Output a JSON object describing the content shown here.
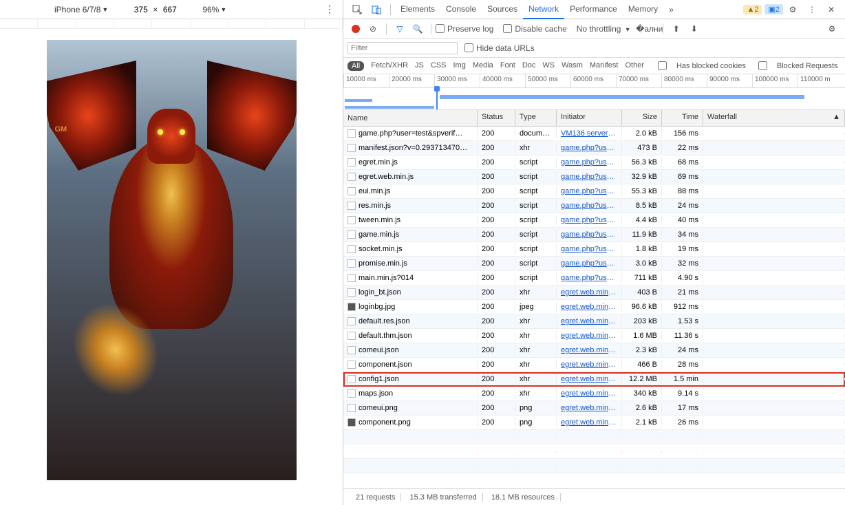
{
  "deviceToolbar": {
    "device": "iPhone 6/7/8",
    "width": "375",
    "height": "667",
    "zoom": "96%"
  },
  "viewport": {
    "gmBadge": "GM"
  },
  "tabs": {
    "items": [
      "Elements",
      "Console",
      "Sources",
      "Network",
      "Performance",
      "Memory"
    ],
    "more": "»",
    "warnCount": "2",
    "infoCount": "2"
  },
  "controls": {
    "preserve": "Preserve log",
    "disableCache": "Disable cache",
    "throttling": "No throttling"
  },
  "filter": {
    "placeholder": "Filter",
    "hideData": "Hide data URLs"
  },
  "types": [
    "All",
    "Fetch/XHR",
    "JS",
    "CSS",
    "Img",
    "Media",
    "Font",
    "Doc",
    "WS",
    "Wasm",
    "Manifest",
    "Other"
  ],
  "typesExtra": {
    "blockedCookies": "Has blocked cookies",
    "blockedReq": "Blocked Requests"
  },
  "timeTicks": [
    "10000 ms",
    "20000 ms",
    "30000 ms",
    "40000 ms",
    "50000 ms",
    "60000 ms",
    "70000 ms",
    "80000 ms",
    "90000 ms",
    "100000 ms",
    "110000 m"
  ],
  "columns": {
    "name": "Name",
    "status": "Status",
    "type": "Type",
    "initiator": "Initiator",
    "size": "Size",
    "time": "Time",
    "waterfall": "Waterfall"
  },
  "requests": [
    {
      "name": "game.php?user=test&spverif…",
      "status": "200",
      "type": "docum…",
      "initiator": "VM136 server1…",
      "size": "2.0 kB",
      "time": "156 ms",
      "wfStart": 0,
      "wfLen": 3,
      "ico": "doc"
    },
    {
      "name": "manifest.json?v=0.293713470…",
      "status": "200",
      "type": "xhr",
      "initiator": "game.php?use…",
      "size": "473 B",
      "time": "22 ms",
      "wfStart": 0,
      "wfLen": 2,
      "ico": "doc"
    },
    {
      "name": "egret.min.js",
      "status": "200",
      "type": "script",
      "initiator": "game.php?use…",
      "size": "56.3 kB",
      "time": "68 ms",
      "wfStart": 0,
      "wfLen": 3,
      "ico": "doc"
    },
    {
      "name": "egret.web.min.js",
      "status": "200",
      "type": "script",
      "initiator": "game.php?use…",
      "size": "32.9 kB",
      "time": "69 ms",
      "wfStart": 0,
      "wfLen": 3,
      "ico": "doc"
    },
    {
      "name": "eui.min.js",
      "status": "200",
      "type": "script",
      "initiator": "game.php?use…",
      "size": "55.3 kB",
      "time": "88 ms",
      "wfStart": 0,
      "wfLen": 3,
      "ico": "doc"
    },
    {
      "name": "res.min.js",
      "status": "200",
      "type": "script",
      "initiator": "game.php?use…",
      "size": "8.5 kB",
      "time": "24 ms",
      "wfStart": 1,
      "wfLen": 2,
      "ico": "doc"
    },
    {
      "name": "tween.min.js",
      "status": "200",
      "type": "script",
      "initiator": "game.php?use…",
      "size": "4.4 kB",
      "time": "40 ms",
      "wfStart": 1,
      "wfLen": 3,
      "ico": "doc"
    },
    {
      "name": "game.min.js",
      "status": "200",
      "type": "script",
      "initiator": "game.php?use…",
      "size": "11.9 kB",
      "time": "34 ms",
      "wfStart": 2,
      "wfLen": 2,
      "ico": "doc"
    },
    {
      "name": "socket.min.js",
      "status": "200",
      "type": "script",
      "initiator": "game.php?use…",
      "size": "1.8 kB",
      "time": "19 ms",
      "wfStart": 2,
      "wfLen": 2,
      "ico": "doc"
    },
    {
      "name": "promise.min.js",
      "status": "200",
      "type": "script",
      "initiator": "game.php?use…",
      "size": "3.0 kB",
      "time": "32 ms",
      "wfStart": 3,
      "wfLen": 2,
      "ico": "doc"
    },
    {
      "name": "main.min.js?014",
      "status": "200",
      "type": "script",
      "initiator": "game.php?use…",
      "size": "711 kB",
      "time": "4.90 s",
      "wfStart": 3,
      "wfLen": 9,
      "ico": "doc"
    },
    {
      "name": "login_bt.json",
      "status": "200",
      "type": "xhr",
      "initiator": "egret.web.min.…",
      "size": "403 B",
      "time": "21 ms",
      "wfStart": 12,
      "wfLen": 2,
      "ico": "doc"
    },
    {
      "name": "loginbg.jpg",
      "status": "200",
      "type": "jpeg",
      "initiator": "egret.web.min.…",
      "size": "96.6 kB",
      "time": "912 ms",
      "wfStart": 12,
      "wfLen": 3,
      "ico": "img"
    },
    {
      "name": "default.res.json",
      "status": "200",
      "type": "xhr",
      "initiator": "egret.web.min.…",
      "size": "203 kB",
      "time": "1.53 s",
      "wfStart": 14,
      "wfLen": 4,
      "ico": "doc"
    },
    {
      "name": "default.thm.json",
      "status": "200",
      "type": "xhr",
      "initiator": "egret.web.min.…",
      "size": "1.6 MB",
      "time": "11.36 s",
      "wfStart": 14,
      "wfLen": 20,
      "ico": "doc"
    },
    {
      "name": "comeui.json",
      "status": "200",
      "type": "xhr",
      "initiator": "egret.web.min.…",
      "size": "2.3 kB",
      "time": "24 ms",
      "wfStart": 35,
      "wfLen": 2,
      "ico": "doc"
    },
    {
      "name": "component.json",
      "status": "200",
      "type": "xhr",
      "initiator": "egret.web.min.…",
      "size": "466 B",
      "time": "28 ms",
      "wfStart": 35,
      "wfLen": 2,
      "ico": "doc"
    },
    {
      "name": "config1.json",
      "status": "200",
      "type": "xhr",
      "initiator": "egret.web.min.…",
      "size": "12.2 MB",
      "time": "1.5 min",
      "wfStart": 36,
      "wfLen": 160,
      "ico": "doc",
      "highlight": true
    },
    {
      "name": "maps.json",
      "status": "200",
      "type": "xhr",
      "initiator": "egret.web.min.…",
      "size": "340 kB",
      "time": "9.14 s",
      "wfStart": 36,
      "wfLen": 16,
      "ico": "doc"
    },
    {
      "name": "comeui.png",
      "status": "200",
      "type": "png",
      "initiator": "egret.web.min.…",
      "size": "2.6 kB",
      "time": "17 ms",
      "wfStart": 52,
      "wfLen": 2,
      "ico": "doc"
    },
    {
      "name": "component.png",
      "status": "200",
      "type": "png",
      "initiator": "egret.web.min.…",
      "size": "2.1 kB",
      "time": "26 ms",
      "wfStart": 52,
      "wfLen": 2,
      "ico": "img"
    }
  ],
  "statusBar": {
    "requests": "21 requests",
    "transferred": "15.3 MB transferred",
    "resources": "18.1 MB resources"
  }
}
